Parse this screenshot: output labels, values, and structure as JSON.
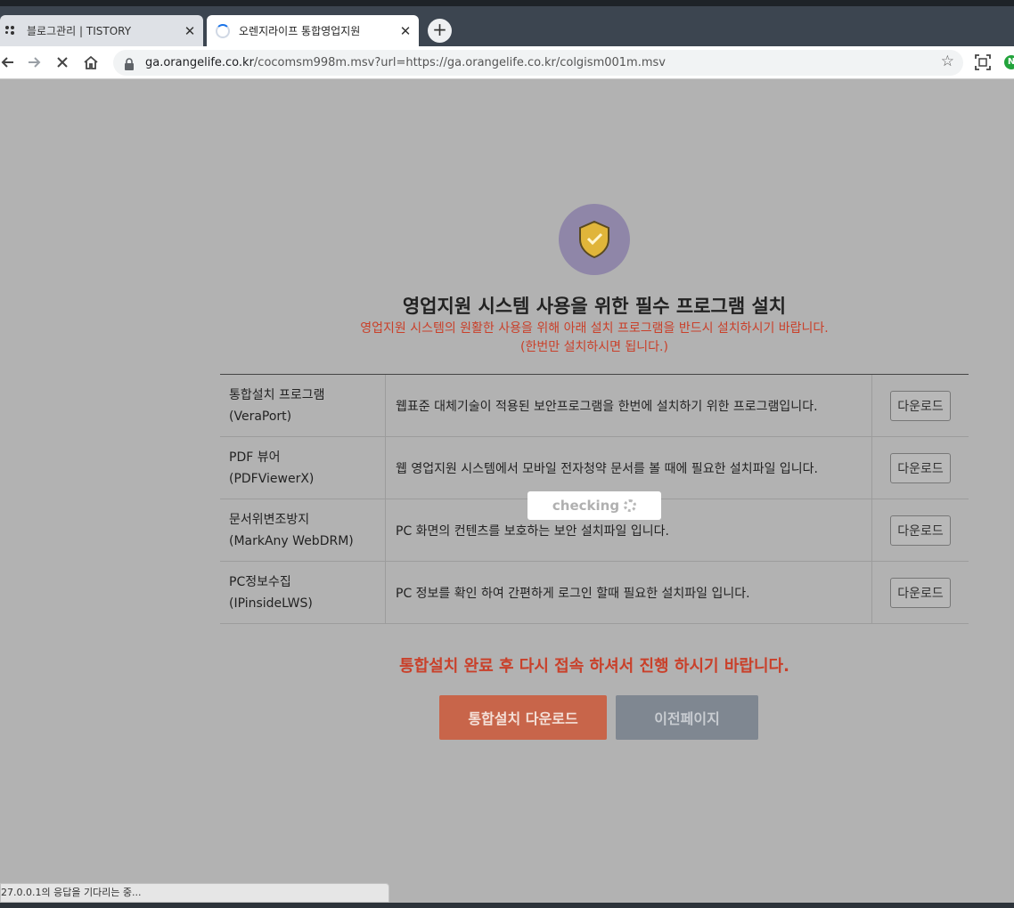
{
  "browser": {
    "tabs": [
      {
        "title": "블로그관리 | TISTORY",
        "icon": "tistory-favicon",
        "active": false
      },
      {
        "title": "오렌지라이프 통합영업지원",
        "icon": "loading-spinner-icon",
        "active": true
      }
    ],
    "close_glyph": "✕",
    "new_tab_glyph": "+",
    "url_host": "ga.orangelife.co.kr",
    "url_rest": "/cocomsm998m.msv?url=https://ga.orangelife.co.kr/colgism001m.msv",
    "status_text": "27.0.0.1의 응답을 기다리는 중..."
  },
  "page": {
    "title": "영업지원 시스템 사용을 위한 필수 프로그램 설치",
    "notice_line1": "영업지원 시스템의 원활한 사용을 위해 아래 설치 프로그램을 반드시 설치하시기 바랍니다.",
    "notice_line2": "(한번만 설치하시면 됩니다.)",
    "programs": [
      {
        "name": "통합설치 프로그램",
        "sub": "(VeraPort)",
        "desc": "웹표준 대체기술이 적용된 보안프로그램을 한번에 설치하기 위한 프로그램입니다.",
        "button": "다운로드"
      },
      {
        "name": "PDF 뷰어",
        "sub": "(PDFViewerX)",
        "desc": "웹 영업지원 시스템에서 모바일 전자청약 문서를 볼 때에 필요한 설치파일 입니다.",
        "button": "다운로드"
      },
      {
        "name": "문서위변조방지",
        "sub": "(MarkAny WebDRM)",
        "desc": "PC 화면의 컨텐츠를 보호하는 보안 설치파일 입니다.",
        "button": "다운로드"
      },
      {
        "name": "PC정보수집",
        "sub": "(IPinsideLWS)",
        "desc": "PC 정보를 확인 하여 간편하게 로그인 할때 필요한 설치파일 입니다.",
        "button": "다운로드"
      }
    ],
    "checking_label": "checking",
    "final_note": "통합설치 완료 후 다시 접속 하셔서 진행 하시기 바랍니다.",
    "install_button": "통합설치 다운로드",
    "prev_button": "이전페이지",
    "colors": {
      "accent_red": "#c9402a",
      "install_btn": "#c8654a",
      "shield_bg": "#8f86a8",
      "shield_gold": "#e0b53a"
    }
  }
}
